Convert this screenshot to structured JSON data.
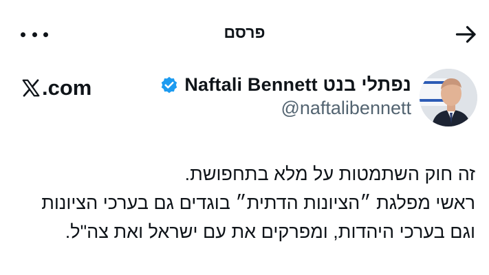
{
  "header": {
    "title": "פרסם",
    "more_icon": "more-horizontal-icon",
    "forward_icon": "arrow-right-icon"
  },
  "author": {
    "display_name": "Naftali Bennett נפתלי בנט",
    "handle": "@naftalibennett",
    "verified": true,
    "verified_color": "#1d9bf0"
  },
  "brand": {
    "text": ".com",
    "logo_icon": "x-logo-icon"
  },
  "post": {
    "lines": [
      "זה חוק השתמטות על מלא בתחפושת.",
      "ראשי מפלגת ״הציונות הדתית״ בוגדים גם בערכי הציונות",
      "וגם בערכי היהדות, ומפרקים את עם ישראל ואת צה\"ל."
    ]
  }
}
